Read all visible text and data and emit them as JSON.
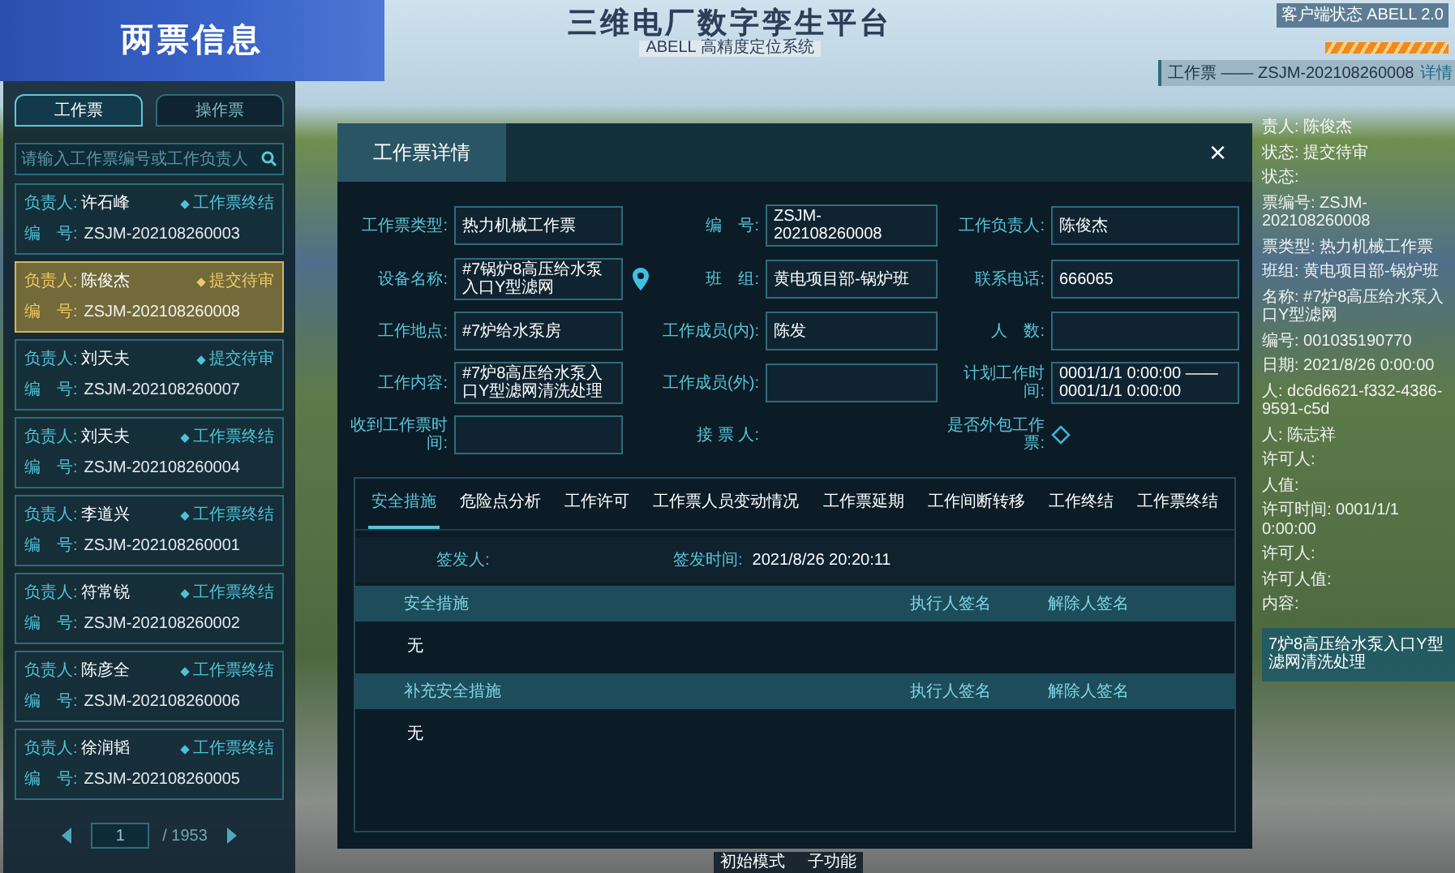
{
  "platform": {
    "title": "三维电厂数字孪生平台",
    "subtitle": "ABELL 高精度定位系统",
    "client_status": "客户端状态 ABELL 2.0"
  },
  "header_banner": {
    "title": "两票信息"
  },
  "sidebar": {
    "tabs": [
      {
        "label": "工作票",
        "selected": true
      },
      {
        "label": "操作票",
        "selected": false
      }
    ],
    "search": {
      "placeholder": "请输入工作票编号或工作负责人"
    },
    "tickets": [
      {
        "owner_label": "负责人:",
        "owner": "许石峰",
        "status": "工作票终结",
        "number_label": "编　号:",
        "number": "ZSJM-202108260003",
        "selected": false
      },
      {
        "owner_label": "负责人:",
        "owner": "陈俊杰",
        "status": "提交待审",
        "number_label": "编　号:",
        "number": "ZSJM-202108260008",
        "selected": true
      },
      {
        "owner_label": "负责人:",
        "owner": "刘天夫",
        "status": "提交待审",
        "number_label": "编　号:",
        "number": "ZSJM-202108260007",
        "selected": false
      },
      {
        "owner_label": "负责人:",
        "owner": "刘天夫",
        "status": "工作票终结",
        "number_label": "编　号:",
        "number": "ZSJM-202108260004",
        "selected": false
      },
      {
        "owner_label": "负责人:",
        "owner": "李道兴",
        "status": "工作票终结",
        "number_label": "编　号:",
        "number": "ZSJM-202108260001",
        "selected": false
      },
      {
        "owner_label": "负责人:",
        "owner": "符常锐",
        "status": "工作票终结",
        "number_label": "编　号:",
        "number": "ZSJM-202108260002",
        "selected": false
      },
      {
        "owner_label": "负责人:",
        "owner": "陈彦全",
        "status": "工作票终结",
        "number_label": "编　号:",
        "number": "ZSJM-202108260006",
        "selected": false
      },
      {
        "owner_label": "负责人:",
        "owner": "徐润韬",
        "status": "工作票终结",
        "number_label": "编　号:",
        "number": "ZSJM-202108260005",
        "selected": false
      }
    ],
    "pagination": {
      "page": "1",
      "total": "/ 1953"
    }
  },
  "right_panel": {
    "header": "工作票 —— ZSJM-202108260008",
    "link": "详情",
    "lines": [
      "责人: 陈俊杰",
      "状态: 提交待审",
      "状态:",
      "票编号: ZSJM-202108260008",
      "票类型: 热力机械工作票",
      "班组: 黄电项目部-锅炉班",
      "名称: #7炉8高压给水泵入口Y型滤网",
      "编号: 001035190770",
      "日期: 2021/8/26 0:00:00",
      "人: dc6d6621-f332-4386-9591-c5d",
      "人: 陈志祥",
      "许可人:",
      "人值:",
      "许可时间: 0001/1/1 0:00:00",
      "许可人:",
      "许可人值:",
      "内容:"
    ],
    "content_box": "7炉8高压给水泵入口Y型滤网清洗处理"
  },
  "bottom_bar": [
    "初始模式",
    "子功能"
  ],
  "modal": {
    "title": "工作票详情",
    "close": "×",
    "fields": [
      {
        "kind": "input",
        "label": "工作票类型:",
        "value": "热力机械工作票"
      },
      {
        "kind": "input",
        "label": "编　号:",
        "value": "ZSJM-202108260008"
      },
      {
        "kind": "input",
        "label": "工作负责人:",
        "value": "陈俊杰"
      },
      {
        "kind": "location",
        "label": "设备名称:",
        "value": "#7锅炉8高压给水泵入口Y型滤网"
      },
      {
        "kind": "input",
        "label": "班　组:",
        "value": "黄电项目部-锅炉班"
      },
      {
        "kind": "input",
        "label": "联系电话:",
        "value": "666065"
      },
      {
        "kind": "input",
        "label": "工作地点:",
        "value": "#7炉给水泵房"
      },
      {
        "kind": "input",
        "label": "工作成员(内):",
        "value": "陈发"
      },
      {
        "kind": "input",
        "label": "人　数:"
      },
      {
        "kind": "input",
        "label": "工作内容:",
        "value": "#7炉8高压给水泵入口Y型滤网清洗处理"
      },
      {
        "kind": "input",
        "label": "工作成员(外):"
      },
      {
        "kind": "input",
        "label": "计划工作时间:",
        "value": "0001/1/1 0:00:00 —— 0001/1/1 0:00:00"
      },
      {
        "kind": "input",
        "label": "收到工作票时间:"
      },
      {
        "kind": "text",
        "label": "接 票 人:"
      },
      {
        "kind": "checkbox",
        "label": "是否外包工作票:",
        "checked": false
      }
    ],
    "tabs": [
      {
        "label": "安全措施",
        "selected": true
      },
      {
        "label": "危险点分析",
        "selected": false
      },
      {
        "label": "工作许可",
        "selected": false
      },
      {
        "label": "工作票人员变动情况",
        "selected": false
      },
      {
        "label": "工作票延期",
        "selected": false
      },
      {
        "label": "工作间断转移",
        "selected": false
      },
      {
        "label": "工作终结",
        "selected": false
      },
      {
        "label": "工作票终结",
        "selected": false
      }
    ],
    "signer": {
      "signer_label": "签发人:",
      "time_label": "签发时间:",
      "time": "2021/8/26 20:20:11"
    },
    "tables": [
      {
        "columns": [
          "安全措施",
          "执行人签名",
          "解除人签名"
        ],
        "rows": [
          [
            "无"
          ]
        ]
      },
      {
        "columns": [
          "补充安全措施",
          "执行人签名",
          "解除人签名"
        ],
        "rows": [
          [
            "无"
          ]
        ]
      }
    ]
  }
}
